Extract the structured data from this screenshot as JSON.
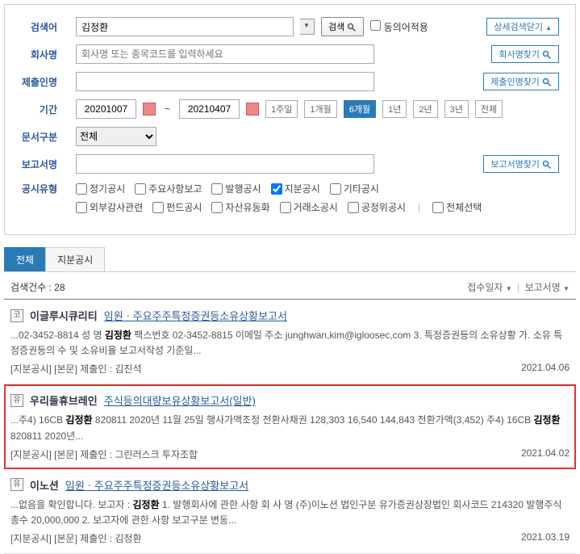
{
  "search": {
    "label_keyword": "검색어",
    "keyword_value": "김정환",
    "btn_search": "검색",
    "chk_synonym": "동의어적용",
    "btn_advanced": "상세검색닫기",
    "label_company": "회사명",
    "company_placeholder": "회사명 또는 종목코드를 입력하세요",
    "btn_company_find": "회사명찾기",
    "label_submitter": "제출인명",
    "btn_submitter_find": "제출인명찾기",
    "label_period": "기간",
    "date_from": "20201007",
    "date_to": "20210407",
    "periods": {
      "w1": "1주일",
      "m1": "1개월",
      "m6": "6개월",
      "y1": "1년",
      "y2": "2년",
      "y3": "3년",
      "all": "전체"
    },
    "label_doctype": "문서구분",
    "doctype_value": "전체",
    "label_report": "보고서명",
    "btn_report_find": "보고서명찾기",
    "label_disctype": "공시유형",
    "disc": {
      "d1": "정기공시",
      "d2": "주요사항보고",
      "d3": "발행공시",
      "d4": "지분공시",
      "d5": "기타공시",
      "d6": "외부감사관련",
      "d7": "펀드공시",
      "d8": "자산유동화",
      "d9": "거래소공시",
      "d10": "공정위공시",
      "d11": "전체선택"
    }
  },
  "tabs": {
    "t1": "전체",
    "t2": "지분공시"
  },
  "results": {
    "count_label": "검색건수 : 28",
    "col_date": "접수일자",
    "col_report": "보고서명",
    "items": [
      {
        "badge": "코",
        "company": "이글루시큐리티",
        "title": "임원ㆍ주요주주특정증권등소유상황보고서",
        "snippet_pre": "...02-3452-8814 성 명 ",
        "snippet_bold": "김정환",
        "snippet_post": " 팩스번호 02-3452-8815 이메일 주소 junghwan,kim@igloosec,com 3. 특정증권등의 소유상황 가. 소유 특정증권등의 수 및 소유비율 보고서작성 기준일...",
        "meta": "[지분공시] [본문] 제출인 : 김진석",
        "date": "2021.04.06"
      },
      {
        "badge": "유",
        "company": "우리들휴브레인",
        "title": "주식등의대량보유상황보고서(일반)",
        "snippet_pre": "...주4) 16CB ",
        "snippet_bold": "김정환",
        "snippet_mid": " 820811 2020년 11월 25일 행사가액조정 전환사채권 128,303 16,540 144,843 전환가액(3,452) 주4) 16CB ",
        "snippet_bold2": "김정환",
        "snippet_post": " 820811 2020년...",
        "meta": "[지분공시] [본문] 제출인 : 그린러스크 투자조합",
        "date": "2021.04.02",
        "highlighted": true
      },
      {
        "badge": "유",
        "company": "이노션",
        "title": "임원ㆍ주요주주특정증권등소유상황보고서",
        "snippet_pre": "...없음을 확인합니다. 보고자 : ",
        "snippet_bold": "김정환",
        "snippet_post": " 1. 발행회사에 관한 사항 회 사 명 (주)이노션 법인구분 유가증권상장법인 회사코드 214320 발행주식 총수 20,000,000 2. 보고자에 관한 사항 보고구분 변동...",
        "meta": "[지분공시] [본문] 제출인 : 김정환",
        "date": "2021.03.19"
      }
    ]
  }
}
